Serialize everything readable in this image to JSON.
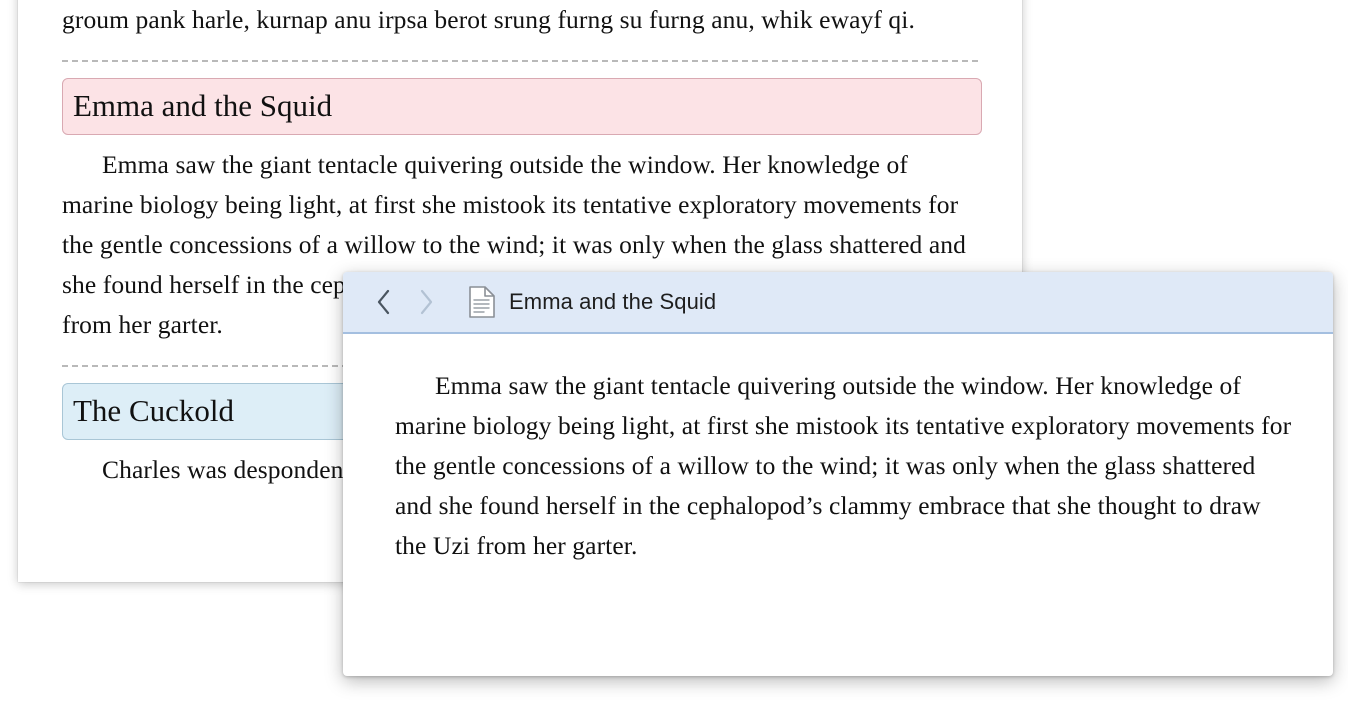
{
  "background_document": {
    "name": "notes-document",
    "top_paragraph": "groum pank harle, kurnap anu irpsa berot srung furng su furng anu, whik ewayf qi.",
    "sections": [
      {
        "heading": "Emma and the Squid",
        "heading_color": "#fce3e6",
        "heading_border_color": "#d9a9b2",
        "paragraph": "Emma saw the giant tentacle quivering outside the window. Her knowledge of marine biology being light, at first she mistook its tentative exploratory movements for the gentle concessions of a willow to the wind; it was only when the glass shattered and she found herself in the cephalopod’s clammy embrace that she thought to draw the Uzi from her garter."
      },
      {
        "heading": "The Cuckold",
        "heading_color": "#ddeef7",
        "heading_border_color": "#a9c6d6",
        "paragraph": "Charles was despondent about the gun. Er arka rintax urfa"
      }
    ]
  },
  "popup": {
    "title": "Emma and the Squid",
    "icon": "document-icon",
    "back_label": "‹",
    "forward_label": "›",
    "titlebar_color": "#dfe9f7",
    "titlebar_border_color": "#a4bfe0",
    "paragraph": "Emma saw the giant tentacle quivering outside the window. Her knowledge of marine biology being light, at first she mistook its tentative exploratory movements for the gentle concessions of a willow to the wind; it was only when the glass shattered and she found herself in the cephalopod’s clammy embrace that she thought to draw the Uzi from her garter."
  }
}
